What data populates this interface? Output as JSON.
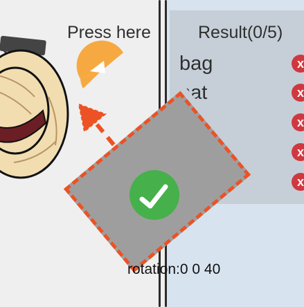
{
  "header": {
    "press_label": "Press here",
    "results_title": "Result(0/5)"
  },
  "results": {
    "items": [
      "bag",
      "hat"
    ],
    "remove_marks": [
      "x",
      "x",
      "x",
      "x",
      "x"
    ]
  },
  "status": {
    "rotation_text": "rotation:0 0 40"
  },
  "colors": {
    "accent": "#ec5224",
    "card": "#9e9e9e",
    "check": "#46b04b",
    "remove": "#d0383f",
    "orange": "#f7a941",
    "panel": "#c6cfd8"
  },
  "icons": {
    "item": "straw-hat-icon",
    "dial": "press-dial-icon",
    "arrow": "direction-arrow-icon",
    "check": "check-icon",
    "remove": "close-circle-icon"
  }
}
